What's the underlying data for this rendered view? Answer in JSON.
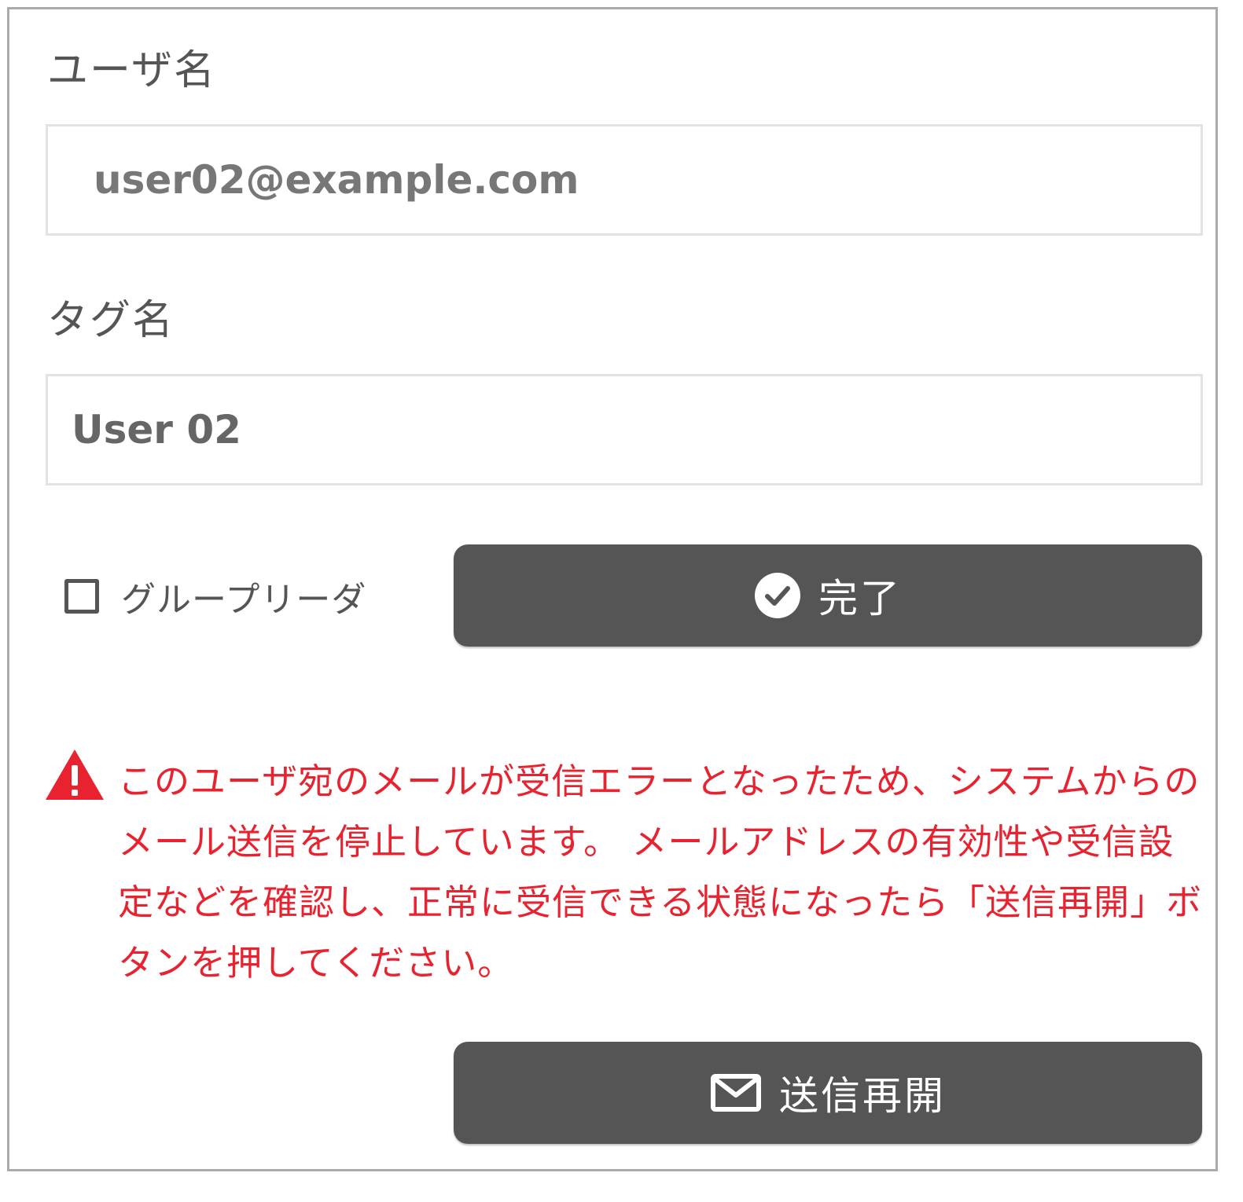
{
  "form": {
    "username": {
      "label": "ユーザ名",
      "value": "user02@example.com"
    },
    "tagname": {
      "label": "タグ名",
      "value": "User 02"
    },
    "group_leader": {
      "label": "グループリーダ",
      "checked": false
    },
    "done_button": {
      "label": "完了",
      "icon": "check-circle-icon"
    }
  },
  "alert": {
    "icon": "warning-triangle-icon",
    "message": "このユーザ宛のメールが受信エラーとなったため、システムからのメール送信を停止しています。 メールアドレスの有効性や受信設定などを確認し、正常に受信できる状態になったら「送信再開」ボタンを押してください。",
    "color": "#e8232f"
  },
  "resend_button": {
    "label": "送信再開",
    "icon": "mail-icon"
  },
  "colors": {
    "button_bg": "#555555",
    "frame_border": "#ababab",
    "input_border": "#e3e3e3",
    "text": "#555555"
  }
}
